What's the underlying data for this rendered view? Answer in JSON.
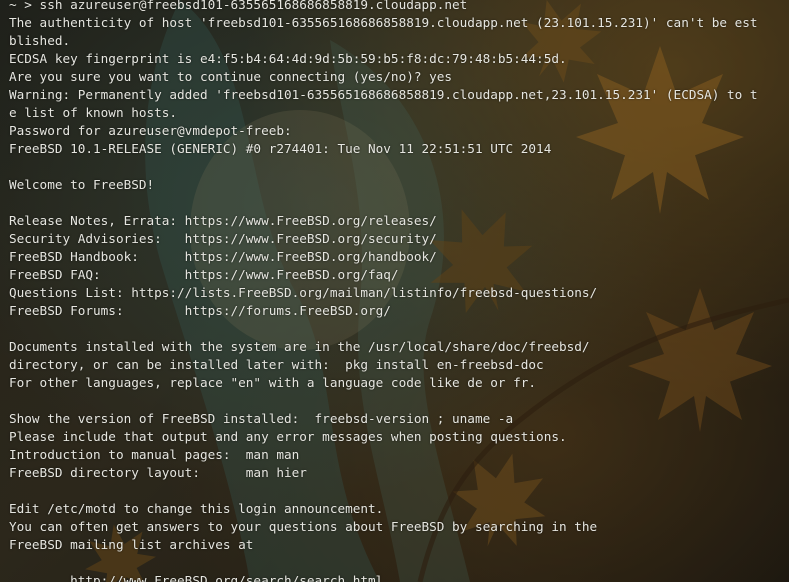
{
  "terminal": {
    "lines": [
      "~ > ssh azureuser@freebsd101-635565168686858819.cloudapp.net",
      "The authenticity of host 'freebsd101-635565168686858819.cloudapp.net (23.101.15.231)' can't be est",
      "blished.",
      "ECDSA key fingerprint is e4:f5:b4:64:4d:9d:5b:59:b5:f8:dc:79:48:b5:44:5d.",
      "Are you sure you want to continue connecting (yes/no)? yes",
      "Warning: Permanently added 'freebsd101-635565168686858819.cloudapp.net,23.101.15.231' (ECDSA) to t",
      "e list of known hosts.",
      "Password for azureuser@vmdepot-freeb:",
      "FreeBSD 10.1-RELEASE (GENERIC) #0 r274401: Tue Nov 11 22:51:51 UTC 2014",
      "",
      "Welcome to FreeBSD!",
      "",
      "Release Notes, Errata: https://www.FreeBSD.org/releases/",
      "Security Advisories:   https://www.FreeBSD.org/security/",
      "FreeBSD Handbook:      https://www.FreeBSD.org/handbook/",
      "FreeBSD FAQ:           https://www.FreeBSD.org/faq/",
      "Questions List: https://lists.FreeBSD.org/mailman/listinfo/freebsd-questions/",
      "FreeBSD Forums:        https://forums.FreeBSD.org/",
      "",
      "Documents installed with the system are in the /usr/local/share/doc/freebsd/",
      "directory, or can be installed later with:  pkg install en-freebsd-doc",
      "For other languages, replace \"en\" with a language code like de or fr.",
      "",
      "Show the version of FreeBSD installed:  freebsd-version ; uname -a",
      "Please include that output and any error messages when posting questions.",
      "Introduction to manual pages:  man man",
      "FreeBSD directory layout:      man hier",
      "",
      "Edit /etc/motd to change this login announcement.",
      "You can often get answers to your questions about FreeBSD by searching in the",
      "FreeBSD mailing list archives at",
      "",
      "        http://www.FreeBSD.org/search/search.html"
    ]
  },
  "colors": {
    "text": "#e6e6e0",
    "leaf_dark": "#6b4310",
    "leaf_light": "#b07a2a",
    "teal_hair": "#4f7a70"
  }
}
